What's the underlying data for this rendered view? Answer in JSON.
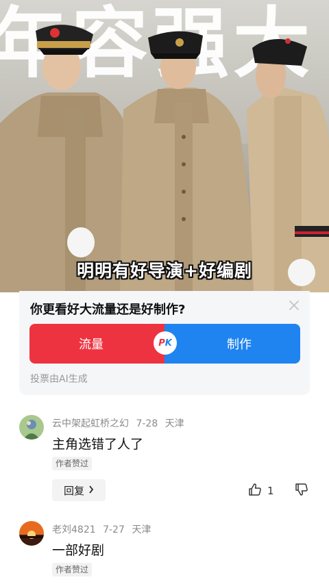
{
  "video": {
    "background_text": "年容强大",
    "subtitle": "明明有好导演+好编剧"
  },
  "poll": {
    "question": "你更看好大流量还是好制作?",
    "option_left": "流量",
    "option_right": "制作",
    "pk_p": "P",
    "pk_k": "K",
    "footer": "投票由AI生成",
    "colors": {
      "left": "#ee3340",
      "right": "#1f84f0"
    }
  },
  "comments": [
    {
      "author": "云中架起虹桥之幻",
      "date": "7-28",
      "location": "天津",
      "text": "主角选错了人了",
      "badge": "作者赞过",
      "reply_label": "回复",
      "likes": "1"
    },
    {
      "author": "老刘4821",
      "date": "7-27",
      "location": "天津",
      "text": "一部好剧",
      "badge": "作者赞过"
    }
  ]
}
